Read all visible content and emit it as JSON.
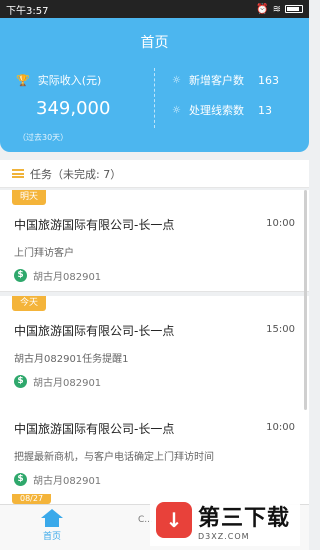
{
  "status_bar": {
    "time": "下午3:57"
  },
  "header": {
    "title": "首页",
    "income_label": "实际收入(元)",
    "income_value": "349,000",
    "income_note": "（过去30天）",
    "new_customers_label": "新增客户数",
    "new_customers_value": "163",
    "leads_label": "处理线索数",
    "leads_value": "13"
  },
  "tasks": {
    "header_label": "任务（未完成: 7）",
    "items": [
      {
        "tag": "明天",
        "company": "中国旅游国际有限公司-长一点",
        "time": "10:00",
        "desc": "上门拜访客户",
        "owner": "胡古月082901"
      },
      {
        "tag": "今天",
        "company": "中国旅游国际有限公司-长一点",
        "time": "15:00",
        "desc": "胡古月082901任务提醒1",
        "owner": "胡古月082901"
      },
      {
        "tag": "",
        "company": "中国旅游国际有限公司-长一点",
        "time": "10:00",
        "desc": "把握最新商机，与客户电话确定上门拜访时间",
        "owner": "胡古月082901"
      }
    ],
    "partial_tag": "08/27"
  },
  "tabbar": {
    "home_label": "首页",
    "second_label": "C..."
  },
  "watermark": {
    "title": "第三下载",
    "url": "D3XZ.COM"
  },
  "colors": {
    "header": "#4cb6ef",
    "tag": "#f4b43a",
    "accent": "#3aa9ea"
  }
}
